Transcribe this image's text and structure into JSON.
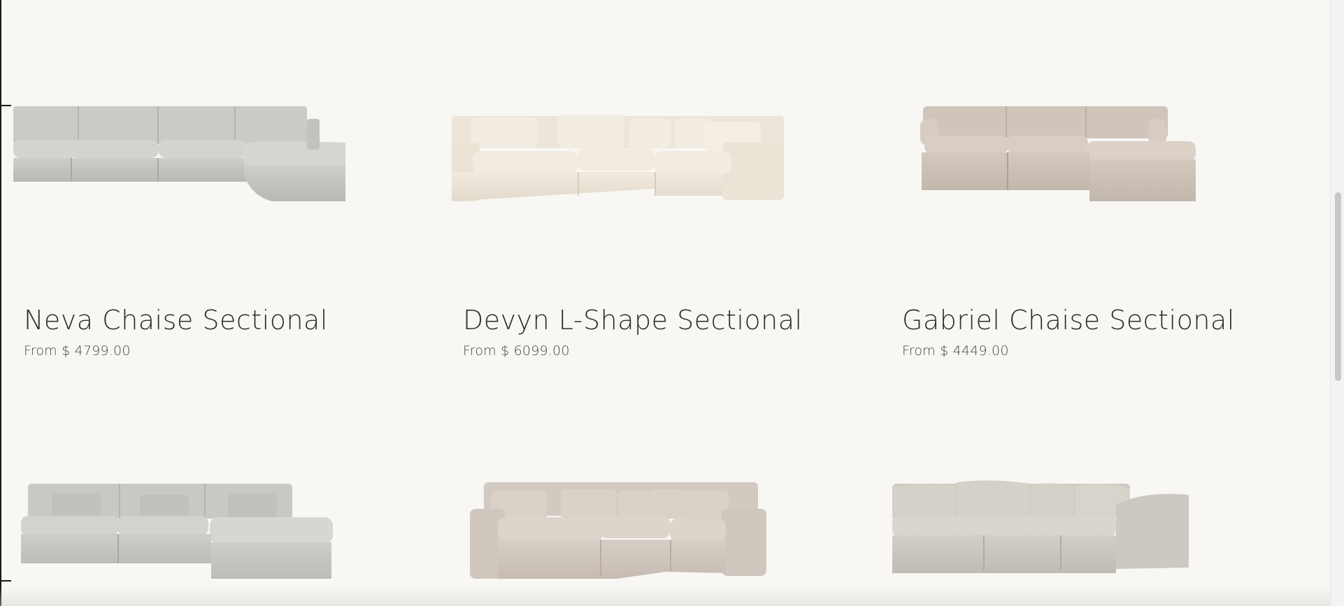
{
  "products": [
    {
      "title": "Neva Chaise Sectional",
      "price": "From $ 4799.00",
      "image_icon": "sofa-image",
      "color": "#c9c8c3"
    },
    {
      "title": "Devyn L-Shape Sectional",
      "price": "From $ 6099.00",
      "image_icon": "sofa-image",
      "color": "#ece4d8"
    },
    {
      "title": "Gabriel Chaise Sectional",
      "price": "From $ 4449.00",
      "image_icon": "sofa-image",
      "color": "#cdc3ba"
    }
  ],
  "row2_images": [
    {
      "image_icon": "sofa-image",
      "color": "#c8c7c3"
    },
    {
      "image_icon": "sofa-image",
      "color": "#d0c7bf"
    },
    {
      "image_icon": "sofa-image",
      "color": "#c8c6bd"
    }
  ]
}
